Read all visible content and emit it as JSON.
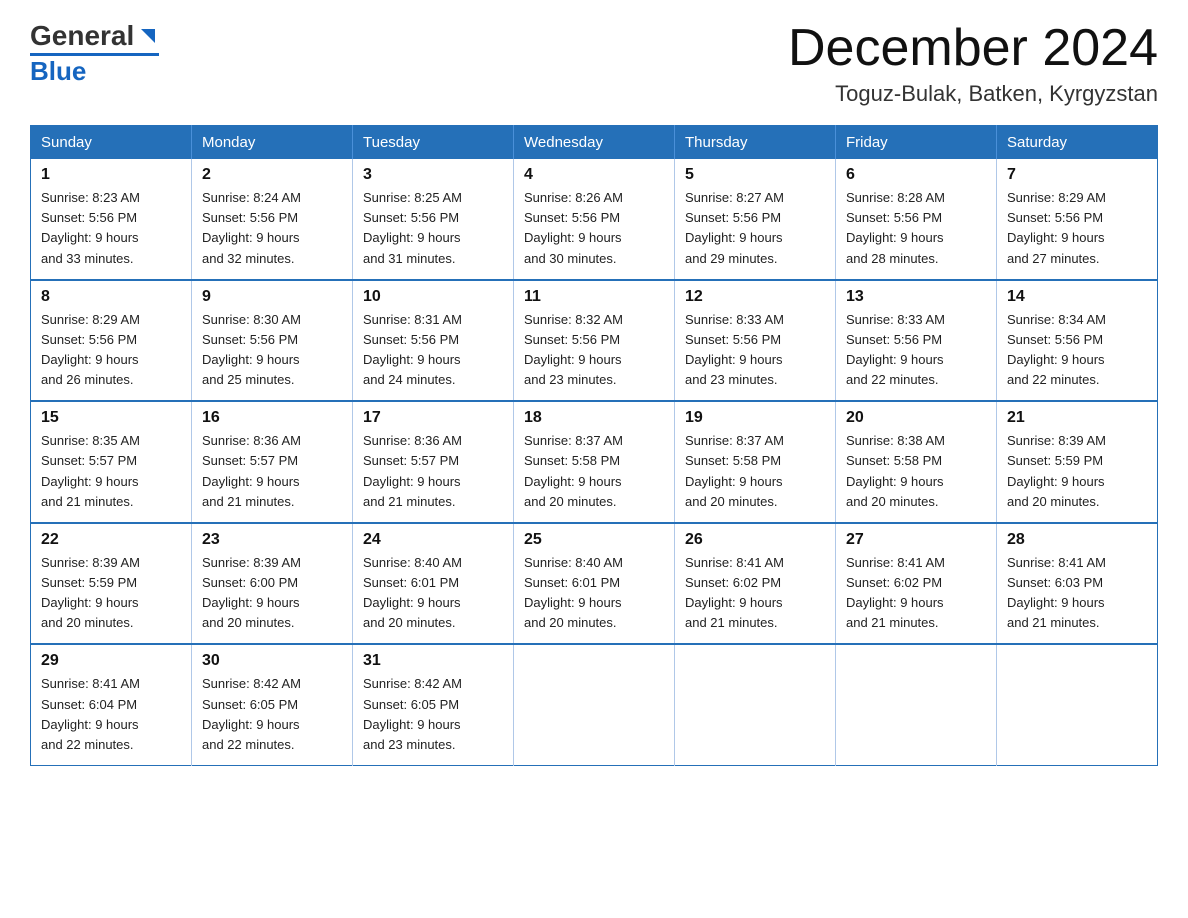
{
  "header": {
    "logo": {
      "general": "General",
      "blue": "Blue",
      "arrow": "▶"
    },
    "title": "December 2024",
    "subtitle": "Toguz-Bulak, Batken, Kyrgyzstan"
  },
  "calendar": {
    "days_of_week": [
      "Sunday",
      "Monday",
      "Tuesday",
      "Wednesday",
      "Thursday",
      "Friday",
      "Saturday"
    ],
    "weeks": [
      [
        {
          "day": "1",
          "sunrise": "8:23 AM",
          "sunset": "5:56 PM",
          "daylight": "9 hours and 33 minutes."
        },
        {
          "day": "2",
          "sunrise": "8:24 AM",
          "sunset": "5:56 PM",
          "daylight": "9 hours and 32 minutes."
        },
        {
          "day": "3",
          "sunrise": "8:25 AM",
          "sunset": "5:56 PM",
          "daylight": "9 hours and 31 minutes."
        },
        {
          "day": "4",
          "sunrise": "8:26 AM",
          "sunset": "5:56 PM",
          "daylight": "9 hours and 30 minutes."
        },
        {
          "day": "5",
          "sunrise": "8:27 AM",
          "sunset": "5:56 PM",
          "daylight": "9 hours and 29 minutes."
        },
        {
          "day": "6",
          "sunrise": "8:28 AM",
          "sunset": "5:56 PM",
          "daylight": "9 hours and 28 minutes."
        },
        {
          "day": "7",
          "sunrise": "8:29 AM",
          "sunset": "5:56 PM",
          "daylight": "9 hours and 27 minutes."
        }
      ],
      [
        {
          "day": "8",
          "sunrise": "8:29 AM",
          "sunset": "5:56 PM",
          "daylight": "9 hours and 26 minutes."
        },
        {
          "day": "9",
          "sunrise": "8:30 AM",
          "sunset": "5:56 PM",
          "daylight": "9 hours and 25 minutes."
        },
        {
          "day": "10",
          "sunrise": "8:31 AM",
          "sunset": "5:56 PM",
          "daylight": "9 hours and 24 minutes."
        },
        {
          "day": "11",
          "sunrise": "8:32 AM",
          "sunset": "5:56 PM",
          "daylight": "9 hours and 23 minutes."
        },
        {
          "day": "12",
          "sunrise": "8:33 AM",
          "sunset": "5:56 PM",
          "daylight": "9 hours and 23 minutes."
        },
        {
          "day": "13",
          "sunrise": "8:33 AM",
          "sunset": "5:56 PM",
          "daylight": "9 hours and 22 minutes."
        },
        {
          "day": "14",
          "sunrise": "8:34 AM",
          "sunset": "5:56 PM",
          "daylight": "9 hours and 22 minutes."
        }
      ],
      [
        {
          "day": "15",
          "sunrise": "8:35 AM",
          "sunset": "5:57 PM",
          "daylight": "9 hours and 21 minutes."
        },
        {
          "day": "16",
          "sunrise": "8:36 AM",
          "sunset": "5:57 PM",
          "daylight": "9 hours and 21 minutes."
        },
        {
          "day": "17",
          "sunrise": "8:36 AM",
          "sunset": "5:57 PM",
          "daylight": "9 hours and 21 minutes."
        },
        {
          "day": "18",
          "sunrise": "8:37 AM",
          "sunset": "5:58 PM",
          "daylight": "9 hours and 20 minutes."
        },
        {
          "day": "19",
          "sunrise": "8:37 AM",
          "sunset": "5:58 PM",
          "daylight": "9 hours and 20 minutes."
        },
        {
          "day": "20",
          "sunrise": "8:38 AM",
          "sunset": "5:58 PM",
          "daylight": "9 hours and 20 minutes."
        },
        {
          "day": "21",
          "sunrise": "8:39 AM",
          "sunset": "5:59 PM",
          "daylight": "9 hours and 20 minutes."
        }
      ],
      [
        {
          "day": "22",
          "sunrise": "8:39 AM",
          "sunset": "5:59 PM",
          "daylight": "9 hours and 20 minutes."
        },
        {
          "day": "23",
          "sunrise": "8:39 AM",
          "sunset": "6:00 PM",
          "daylight": "9 hours and 20 minutes."
        },
        {
          "day": "24",
          "sunrise": "8:40 AM",
          "sunset": "6:01 PM",
          "daylight": "9 hours and 20 minutes."
        },
        {
          "day": "25",
          "sunrise": "8:40 AM",
          "sunset": "6:01 PM",
          "daylight": "9 hours and 20 minutes."
        },
        {
          "day": "26",
          "sunrise": "8:41 AM",
          "sunset": "6:02 PM",
          "daylight": "9 hours and 21 minutes."
        },
        {
          "day": "27",
          "sunrise": "8:41 AM",
          "sunset": "6:02 PM",
          "daylight": "9 hours and 21 minutes."
        },
        {
          "day": "28",
          "sunrise": "8:41 AM",
          "sunset": "6:03 PM",
          "daylight": "9 hours and 21 minutes."
        }
      ],
      [
        {
          "day": "29",
          "sunrise": "8:41 AM",
          "sunset": "6:04 PM",
          "daylight": "9 hours and 22 minutes."
        },
        {
          "day": "30",
          "sunrise": "8:42 AM",
          "sunset": "6:05 PM",
          "daylight": "9 hours and 22 minutes."
        },
        {
          "day": "31",
          "sunrise": "8:42 AM",
          "sunset": "6:05 PM",
          "daylight": "9 hours and 23 minutes."
        },
        null,
        null,
        null,
        null
      ]
    ],
    "labels": {
      "sunrise": "Sunrise:",
      "sunset": "Sunset:",
      "daylight": "Daylight:"
    }
  }
}
